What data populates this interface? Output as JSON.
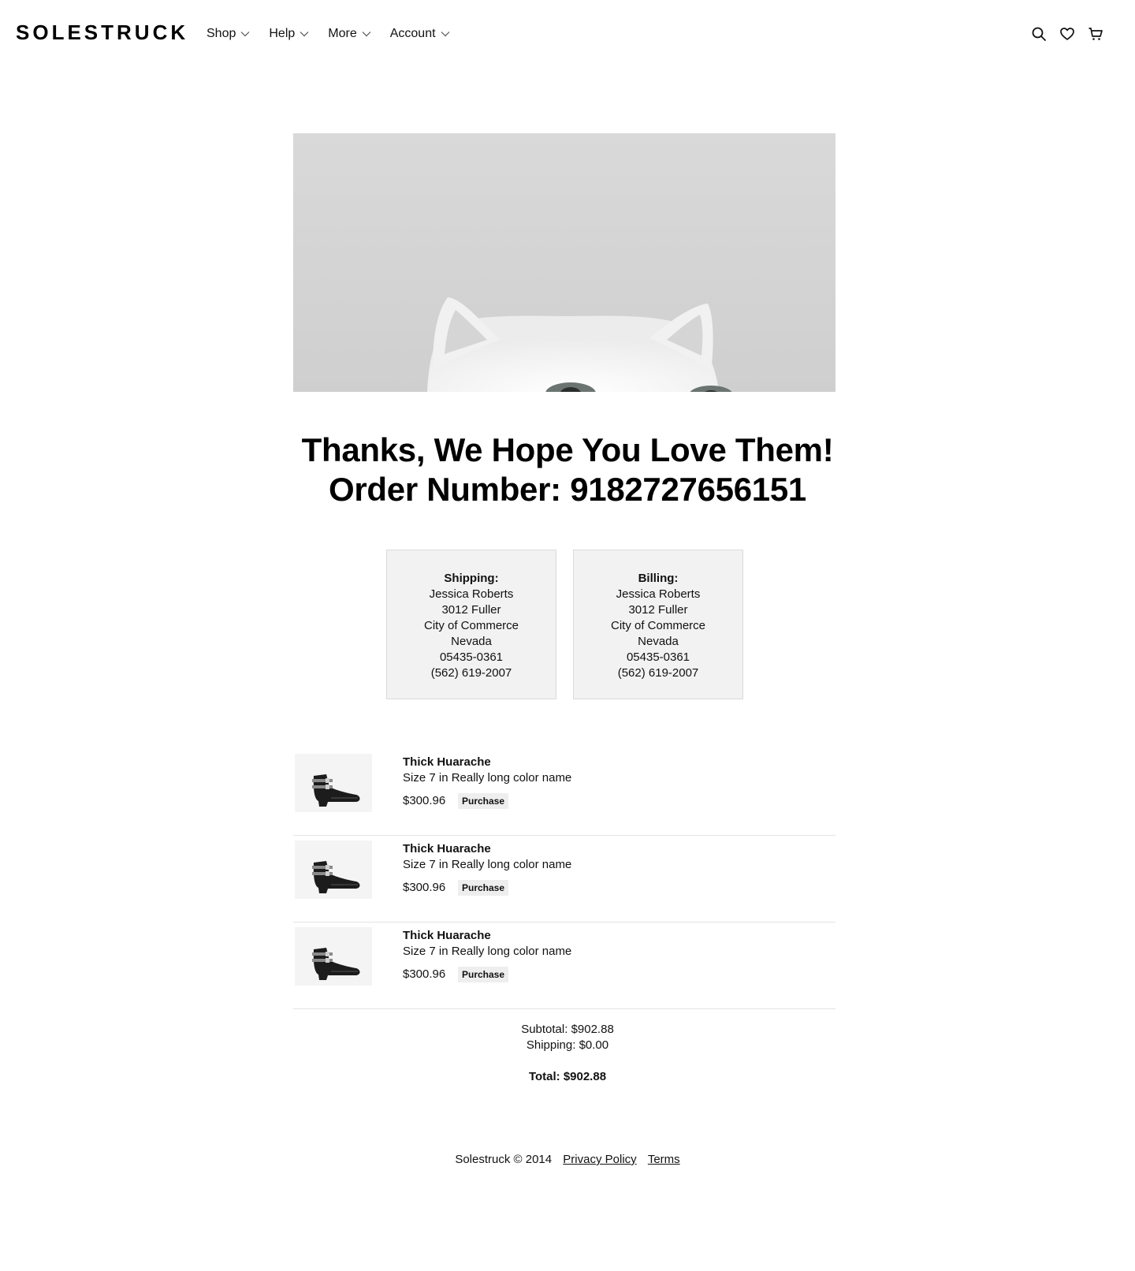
{
  "header": {
    "logo": "SOLESTRUCK",
    "nav": [
      {
        "label": "Shop"
      },
      {
        "label": "Help"
      },
      {
        "label": "More"
      },
      {
        "label": "Account"
      }
    ],
    "icons": [
      "search-icon",
      "heart-icon",
      "cart-icon"
    ]
  },
  "hero": {
    "image": "cat-peeking-photo"
  },
  "confirmation": {
    "line1": "Thanks, We Hope You Love Them!",
    "line2": "Order Number: 9182727656151"
  },
  "shipping": {
    "title": "Shipping:",
    "name": "Jessica Roberts",
    "street": "3012 Fuller",
    "city": "City of Commerce",
    "state": "Nevada",
    "zip": "05435-0361",
    "phone": "(562) 619-2007"
  },
  "billing": {
    "title": "Billing:",
    "name": "Jessica Roberts",
    "street": "3012 Fuller",
    "city": "City of Commerce",
    "state": "Nevada",
    "zip": "05435-0361",
    "phone": "(562) 619-2007"
  },
  "items": [
    {
      "name": "Thick Huarache",
      "variant": "Size 7 in Really long color name",
      "price": "$300.96",
      "action": "Purchase"
    },
    {
      "name": "Thick Huarache",
      "variant": "Size 7 in Really long color name",
      "price": "$300.96",
      "action": "Purchase"
    },
    {
      "name": "Thick Huarache",
      "variant": "Size 7 in Really long color name",
      "price": "$300.96",
      "action": "Purchase"
    }
  ],
  "totals": {
    "subtotal": "Subtotal: $902.88",
    "shipping": "Shipping: $0.00",
    "total": "Total: $902.88"
  },
  "footer": {
    "copyright": "Solestruck © 2014",
    "privacy": "Privacy Policy",
    "terms": "Terms"
  }
}
